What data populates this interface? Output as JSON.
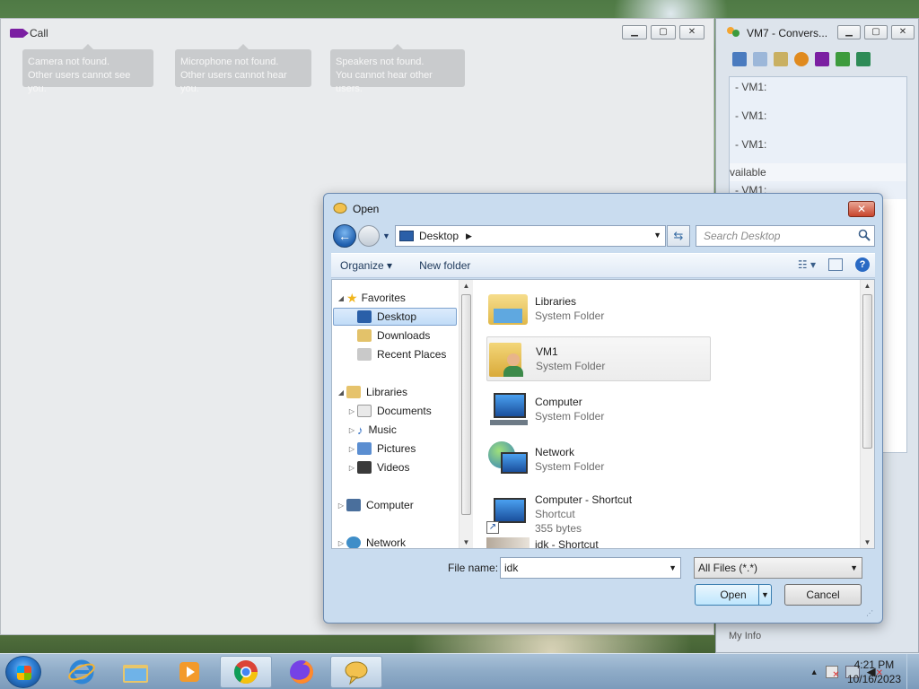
{
  "call_window": {
    "title": "Call",
    "notices": [
      {
        "line1": "Camera not found.",
        "line2": "Other users cannot see you."
      },
      {
        "line1": "Microphone not found.",
        "line2": "Other users cannot hear you."
      },
      {
        "line1": "Speakers not found.",
        "line2": "You cannot hear other users."
      }
    ]
  },
  "conversation_window": {
    "title": "VM7 - Convers...",
    "messages": [
      "- VM1:",
      "- VM1:",
      "- VM1:",
      "vailable",
      "- VM1:"
    ],
    "footer": "My Info"
  },
  "dialog": {
    "title": "Open",
    "address": "Desktop",
    "search_placeholder": "Search Desktop",
    "commands": {
      "organize": "Organize",
      "new_folder": "New folder"
    },
    "nav": {
      "favorites": "Favorites",
      "desktop": "Desktop",
      "downloads": "Downloads",
      "recent_places": "Recent Places",
      "libraries": "Libraries",
      "documents": "Documents",
      "music": "Music",
      "pictures": "Pictures",
      "videos": "Videos",
      "computer": "Computer",
      "network": "Network"
    },
    "items": [
      {
        "name": "Libraries",
        "type": "System Folder",
        "size": ""
      },
      {
        "name": "VM1",
        "type": "System Folder",
        "size": ""
      },
      {
        "name": "Computer",
        "type": "System Folder",
        "size": ""
      },
      {
        "name": "Network",
        "type": "System Folder",
        "size": ""
      },
      {
        "name": "Computer - Shortcut",
        "type": "Shortcut",
        "size": "355 bytes"
      },
      {
        "name": "idk - Shortcut",
        "type": "",
        "size": ""
      }
    ],
    "file_name_label": "File name:",
    "file_name_value": "idk",
    "filter": "All Files (*.*)",
    "open_button": "Open",
    "cancel_button": "Cancel"
  },
  "taskbar": {
    "time": "4:21 PM",
    "date": "10/16/2023"
  },
  "colors": {
    "call_accent": "#7b1fa2",
    "close_red": "#c8452c",
    "selection": "#c1dcf7"
  }
}
